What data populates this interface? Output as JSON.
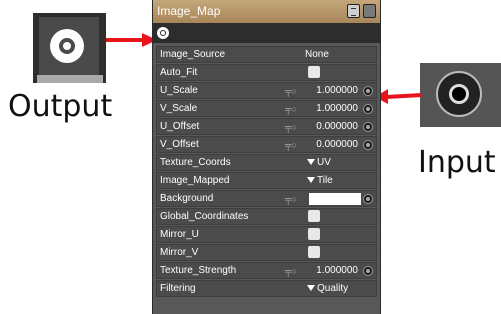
{
  "callouts": {
    "output_label": "Output",
    "input_label": "Input"
  },
  "node": {
    "title": "Image_Map",
    "rows": [
      {
        "label": "Image_Source",
        "value": "None"
      },
      {
        "label": "Auto_Fit"
      },
      {
        "label": "U_Scale",
        "value": "1.000000"
      },
      {
        "label": "V_Scale",
        "value": "1.000000"
      },
      {
        "label": "U_Offset",
        "value": "0.000000"
      },
      {
        "label": "V_Offset",
        "value": "0.000000"
      },
      {
        "label": "Texture_Coords",
        "value": "UV"
      },
      {
        "label": "Image_Mapped",
        "value": "Tile"
      },
      {
        "label": "Background"
      },
      {
        "label": "Global_Coordinates"
      },
      {
        "label": "Mirror_U"
      },
      {
        "label": "Mirror_V"
      },
      {
        "label": "Texture_Strength",
        "value": "1.000000"
      },
      {
        "label": "Filtering",
        "value": "Quality"
      }
    ]
  },
  "colors": {
    "title_bar": "#b08f62",
    "panel": "#585858",
    "arrow": "#e8141c"
  }
}
